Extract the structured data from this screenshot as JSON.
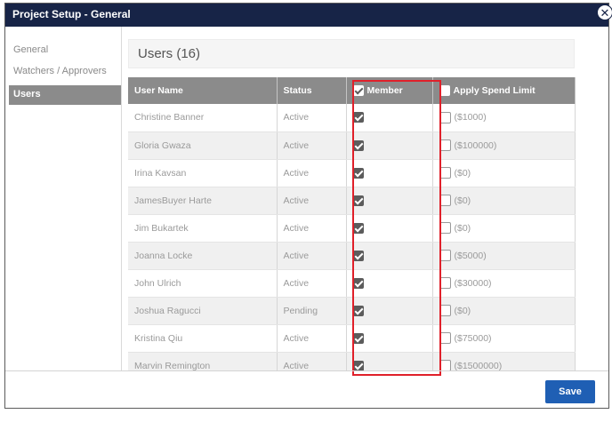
{
  "dialog": {
    "title": "Project Setup - General",
    "close_glyph": "✕"
  },
  "sidebar": {
    "items": [
      {
        "label": "General",
        "active": false
      },
      {
        "label": "Watchers / Approvers",
        "active": false
      },
      {
        "label": "Users",
        "active": true
      }
    ]
  },
  "users": {
    "heading": "Users (16)",
    "columns": {
      "name": "User Name",
      "status": "Status",
      "member": "Member",
      "spend": "Apply Spend Limit"
    },
    "rows": [
      {
        "name": "Christine Banner",
        "status": "Active",
        "member": true,
        "spend_checked": false,
        "spend": "($1000)"
      },
      {
        "name": "Gloria Gwaza",
        "status": "Active",
        "member": true,
        "spend_checked": false,
        "spend": "($100000)"
      },
      {
        "name": "Irina Kavsan",
        "status": "Active",
        "member": true,
        "spend_checked": false,
        "spend": "($0)"
      },
      {
        "name": "JamesBuyer Harte",
        "status": "Active",
        "member": true,
        "spend_checked": false,
        "spend": "($0)"
      },
      {
        "name": "Jim Bukartek",
        "status": "Active",
        "member": true,
        "spend_checked": false,
        "spend": "($0)"
      },
      {
        "name": "Joanna Locke",
        "status": "Active",
        "member": true,
        "spend_checked": false,
        "spend": "($5000)"
      },
      {
        "name": "John Ulrich",
        "status": "Active",
        "member": true,
        "spend_checked": false,
        "spend": "($30000)"
      },
      {
        "name": "Joshua Ragucci",
        "status": "Pending",
        "member": true,
        "spend_checked": false,
        "spend": "($0)"
      },
      {
        "name": "Kristina Qiu",
        "status": "Active",
        "member": true,
        "spend_checked": false,
        "spend": "($75000)"
      },
      {
        "name": "Marvin Remington",
        "status": "Active",
        "member": true,
        "spend_checked": false,
        "spend": "($1500000)"
      }
    ]
  },
  "footer": {
    "save_label": "Save"
  },
  "colors": {
    "titlebar": "#172447",
    "header_row": "#8b8b8b",
    "highlight": "#e0202a",
    "save_button": "#1f5fb4"
  }
}
